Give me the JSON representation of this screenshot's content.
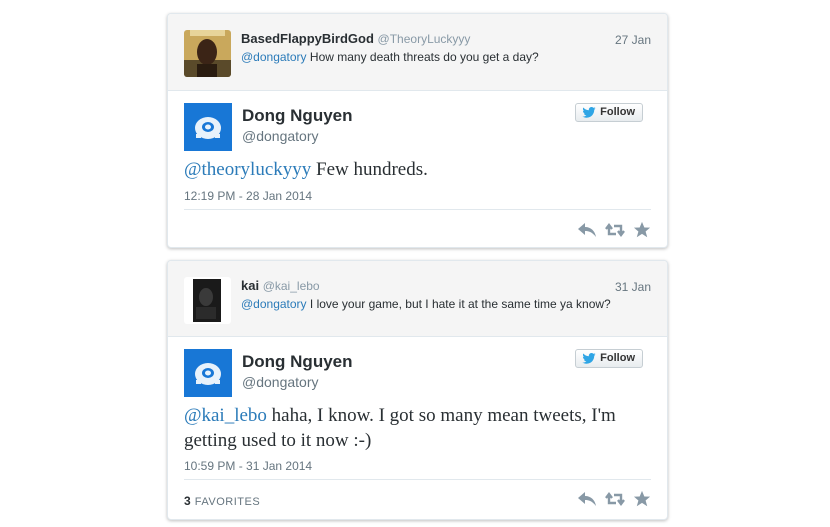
{
  "tweets": [
    {
      "reply": {
        "name": "BasedFlappyBirdGod",
        "handle": "@TheoryLuckyyy",
        "date": "27 Jan",
        "mention": "@dongatory",
        "text": " How many death threats do you get a day?"
      },
      "main": {
        "name": "Dong Nguyen",
        "handle": "@dongatory",
        "follow_label": "Follow",
        "mention": "@theoryluckyyy",
        "text": " Few hundreds.",
        "timestamp": "12:19 PM - 28 Jan 2014"
      }
    },
    {
      "reply": {
        "name": "kai",
        "handle": "@kai_lebo",
        "date": "31 Jan",
        "mention": "@dongatory",
        "text": " I love your game, but I hate it at the same time ya know?"
      },
      "main": {
        "name": "Dong Nguyen",
        "handle": "@dongatory",
        "follow_label": "Follow",
        "mention": "@kai_lebo",
        "text": " haha, I know. I got so many mean tweets, I'm getting used to it now :-)",
        "timestamp": "10:59 PM - 31 Jan 2014",
        "favorites_count": "3",
        "favorites_label": "FAVORITES"
      }
    }
  ],
  "colors": {
    "link": "#2b7bb9",
    "avatar_blue": "#1877d6",
    "twitter_bird": "#2fa5e5",
    "action_icon": "#8899a6"
  }
}
